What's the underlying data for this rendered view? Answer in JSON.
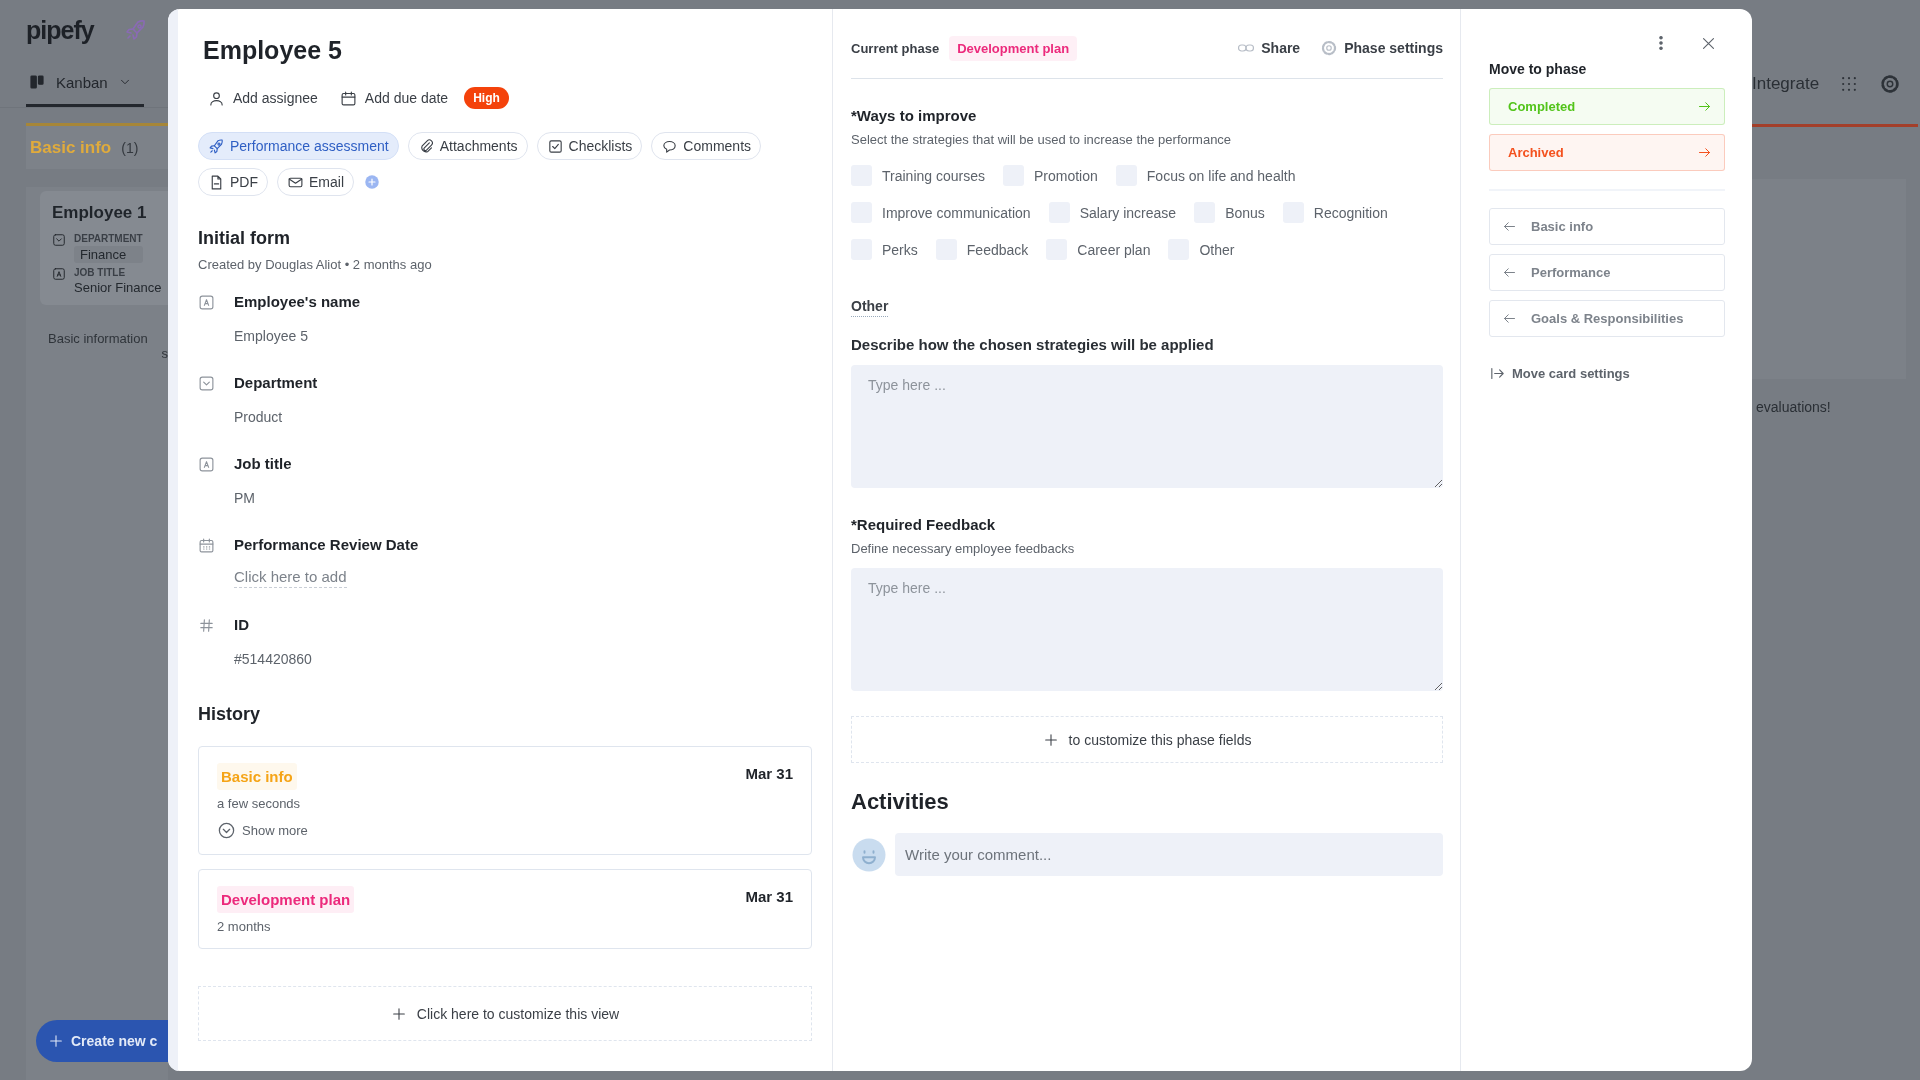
{
  "background": {
    "logo": "pipefy",
    "view_tab": "Kanban",
    "column": {
      "title": "Basic info",
      "count": "(1)"
    },
    "card": {
      "title": "Employee 1",
      "fields": [
        {
          "kind": "select",
          "label": "DEPARTMENT",
          "value": "Finance"
        },
        {
          "kind": "text",
          "label": "JOB TITLE",
          "value": "Senior Finance"
        }
      ]
    },
    "column_note": [
      "Basic information",
      "s"
    ],
    "create_button": "Create new c",
    "integrate": "Integrate",
    "note": "evaluations!"
  },
  "card": {
    "title": "Employee 5",
    "actions": [
      "Add assignee",
      "Add due date"
    ],
    "priority": "High",
    "tabs": [
      {
        "label": "Performance assessment",
        "selected": true
      },
      {
        "label": "Attachments",
        "selected": false
      },
      {
        "label": "Checklists",
        "selected": false
      },
      {
        "label": "Comments",
        "selected": false
      },
      {
        "label": "PDF",
        "selected": false
      },
      {
        "label": "Email",
        "selected": false
      }
    ],
    "initial_form": {
      "title": "Initial form",
      "meta": "Created by Douglas Aliot • 2 months ago",
      "fields": [
        {
          "kind": "text",
          "label": "Employee's name",
          "value": "Employee 5"
        },
        {
          "kind": "select",
          "label": "Department",
          "value": "Product"
        },
        {
          "kind": "text",
          "label": "Job title",
          "value": "PM"
        },
        {
          "kind": "date",
          "label": "Performance Review Date",
          "prompt": "Click here to add"
        },
        {
          "kind": "id",
          "label": "ID",
          "value": "#514420860"
        }
      ]
    },
    "history": {
      "title": "History",
      "entries": [
        {
          "phase": "Basic info",
          "color": "#f5a417",
          "date": "Mar 31",
          "duration": "a few seconds",
          "show_more": "Show more"
        },
        {
          "phase": "Development plan",
          "color": "#ec2a7c",
          "date": "Mar 31",
          "duration": "2 months"
        }
      ]
    },
    "customize": "Click here to customize this view"
  },
  "phase": {
    "label": "Current phase",
    "current": {
      "label": "Development plan",
      "color": "#ec2a7c"
    },
    "share": "Share",
    "settings": "Phase settings",
    "ways": {
      "title": "*Ways to improve",
      "description": "Select the strategies that will be used to increase the performance",
      "option_rows": [
        [
          {
            "label": "Training courses",
            "checked": false
          },
          {
            "label": "Promotion",
            "checked": false
          },
          {
            "label": "Focus on life and health",
            "checked": false
          }
        ],
        [
          {
            "label": "Improve communication",
            "checked": false
          },
          {
            "label": "Salary increase",
            "checked": false
          },
          {
            "label": "Bonus",
            "checked": false
          },
          {
            "label": "Recognition",
            "checked": false
          }
        ],
        [
          {
            "label": "Perks",
            "checked": false
          },
          {
            "label": "Feedback",
            "checked": false
          },
          {
            "label": "Career plan",
            "checked": false
          },
          {
            "label": "Other",
            "checked": false
          }
        ]
      ]
    },
    "other_label": "Other",
    "describe": {
      "label": "Describe how the chosen strategies will be applied",
      "placeholder": "Type here ..."
    },
    "feedback": {
      "label": "*Required Feedback",
      "description": "Define necessary employee feedbacks",
      "placeholder": "Type here ..."
    },
    "customize": "to customize this phase fields",
    "activities": {
      "title": "Activities",
      "placeholder": "Write your comment..."
    }
  },
  "move": {
    "title": "Move to phase",
    "forward": [
      {
        "label": "Completed",
        "color": "#52c41a"
      },
      {
        "label": "Archived",
        "color": "#f4511e"
      }
    ],
    "back": [
      "Basic info",
      "Performance",
      "Goals & Responsibilities"
    ],
    "settings": "Move card settings"
  }
}
